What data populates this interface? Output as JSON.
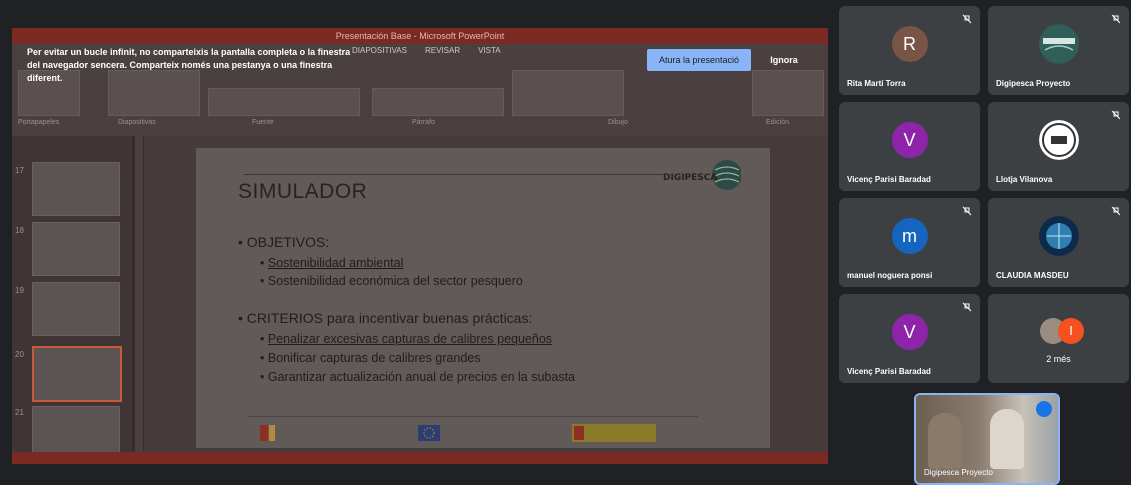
{
  "share_banner": {
    "message": "Per evitar un bucle infinit, no comparteixis la pantalla completa o la finestra del navegador sencera. Comparteix només una pestanya o una finestra diferent.",
    "stop_label": "Atura la presentació",
    "ignore_label": "Ignora"
  },
  "powerpoint": {
    "title": "Presentación Base - Microsoft PowerPoint",
    "tabs": [
      "DIAPOSITIVAS",
      "REVISAR",
      "VISTA"
    ],
    "groups": [
      "Portapapeles",
      "Diapositivas",
      "Fuente",
      "Párrafo",
      "Dibujo",
      "Edición"
    ],
    "thumb_numbers": [
      "17",
      "18",
      "19",
      "20",
      "21"
    ],
    "slide": {
      "title": "SIMULADOR",
      "logo_text": "DIGIPESCA",
      "section1_heading": "OBJETIVOS:",
      "section1_items": [
        "Sostenibilidad ambiental",
        "Sostenibilidad económica del sector pesquero"
      ],
      "section2_heading": "CRITERIOS para incentivar buenas prácticas:",
      "section2_items": [
        "Penalizar excesivas capturas de calibres pequeños",
        "Bonificar capturas de calibres grandes",
        "Garantizar actualización anual de precios en la subasta"
      ],
      "footer_logo1": "Plan de Recuperación, Transformación y Resiliencia",
      "footer_logo2": "Financiado por la Unión Europea NextGenerationEU"
    }
  },
  "participants": [
    {
      "name": "Rita Martí Torra",
      "initial": "R",
      "color": "#795548",
      "type": "initial"
    },
    {
      "name": "Digipesca Proyecto",
      "type": "logo",
      "logo": "digipesca-logo"
    },
    {
      "name": "Vicenç Parisi Baradad",
      "initial": "V",
      "color": "#8e24aa",
      "type": "initial"
    },
    {
      "name": "Llotja Vilanova",
      "type": "logo",
      "logo": "llotja-logo"
    },
    {
      "name": "manuel noguera ponsi",
      "initial": "m",
      "color": "#1565c0",
      "type": "initial"
    },
    {
      "name": "CLAUDIA MASDEU",
      "type": "logo",
      "logo": "globe-logo"
    },
    {
      "name": "Vicenç Parisi Baradad",
      "initial": "V",
      "color": "#8e24aa",
      "type": "initial"
    },
    {
      "name": "2 més",
      "initial": "I",
      "color": "#f4511e",
      "type": "more"
    }
  ],
  "self_view": {
    "name": "Digipesca Proyecto"
  },
  "icons": {
    "mute": "mic-off-icon",
    "speaking": "audio-level-icon"
  }
}
